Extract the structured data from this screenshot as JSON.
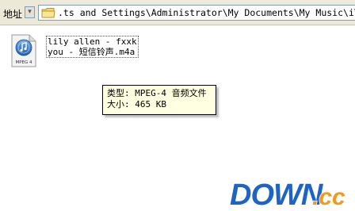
{
  "address_bar": {
    "label": "地址",
    "path": ".ts and Settings\\Administrator\\My Documents\\My Music\\iTunes\\iTu"
  },
  "file": {
    "icon_name": "mpeg4-audio-file-icon",
    "icon_caption": "MPEG 4",
    "name_line1": "lily allen - fxxk",
    "name_line2": "you - 短信铃声.m4a"
  },
  "tooltip": {
    "type_line": "类型: MPEG-4 音频文件",
    "size_line": "大小: 465 KB"
  },
  "watermark": {
    "text_main": "DOWN",
    "text_suffix": ".cc"
  },
  "colors": {
    "toolbar_bg": "#ece9d8",
    "tooltip_bg": "#ffffe1",
    "watermark_blue": "#1f63c4",
    "watermark_orange": "#f39a1c"
  }
}
